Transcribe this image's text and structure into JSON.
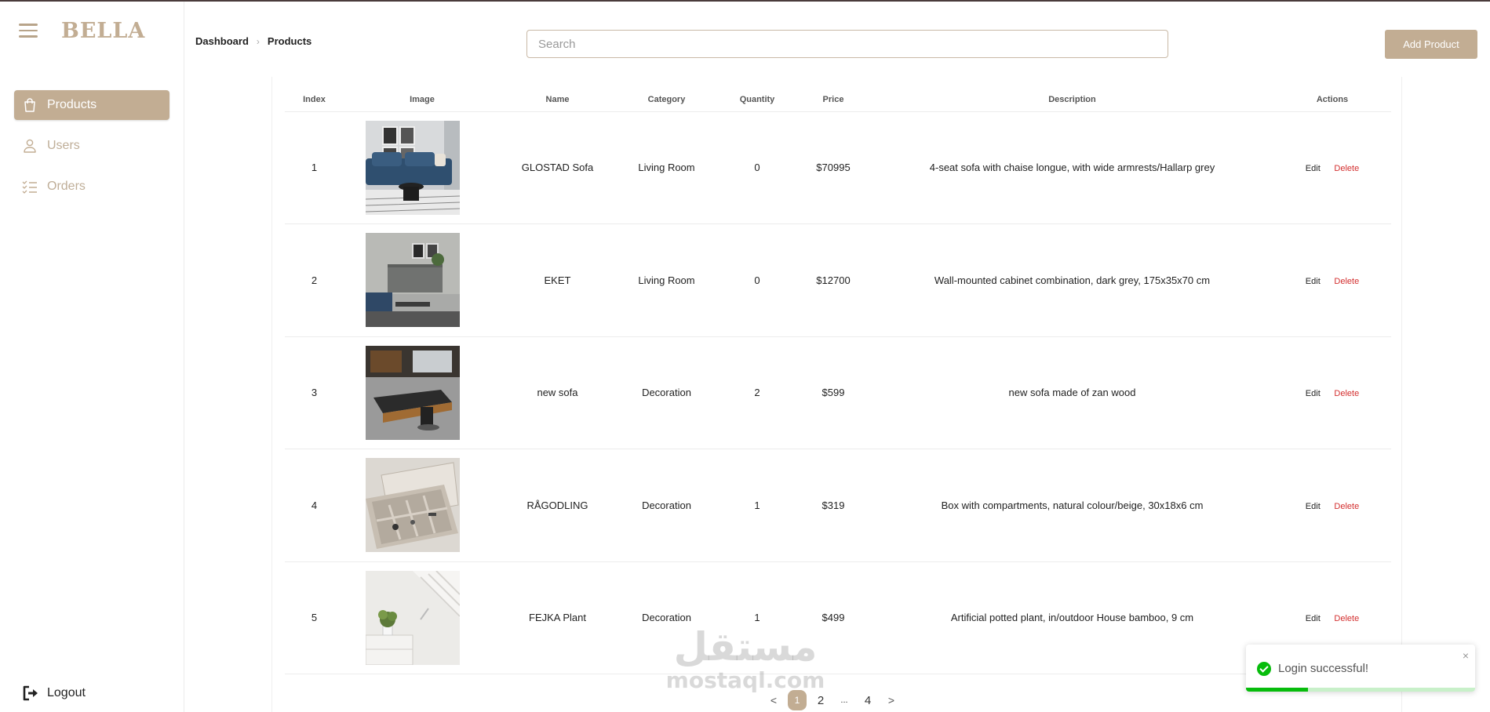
{
  "brand": {
    "name": "BELLA"
  },
  "sidebar": {
    "items": [
      {
        "label": "Products",
        "icon": "shopping-bag-icon",
        "active": true
      },
      {
        "label": "Users",
        "icon": "user-icon",
        "active": false
      },
      {
        "label": "Orders",
        "icon": "checklist-icon",
        "active": false
      }
    ],
    "logout_label": "Logout"
  },
  "breadcrumb": {
    "root": "Dashboard",
    "current": "Products"
  },
  "search": {
    "placeholder": "Search",
    "value": ""
  },
  "header": {
    "add_button_label": "Add Product"
  },
  "table": {
    "columns": [
      "Index",
      "Image",
      "Name",
      "Category",
      "Quantity",
      "Price",
      "Description",
      "Actions"
    ],
    "rows": [
      {
        "index": "1",
        "image": "blue-sofa-room-photo",
        "name": "GLOSTAD Sofa",
        "category": "Living Room",
        "quantity": "0",
        "price": "$70995",
        "description": "4-seat sofa with chaise longue, with wide armrests/Hallarp grey",
        "edit": "Edit",
        "delete": "Delete"
      },
      {
        "index": "2",
        "image": "grey-cabinet-room-photo",
        "name": "EKET",
        "category": "Living Room",
        "quantity": "0",
        "price": "$12700",
        "description": "Wall-mounted cabinet combination, dark grey, 175x35x70 cm",
        "edit": "Edit",
        "delete": "Delete"
      },
      {
        "index": "3",
        "image": "office-desk-photo",
        "name": "new sofa",
        "category": "Decoration",
        "quantity": "2",
        "price": "$599",
        "description": "new sofa made of zan wood",
        "edit": "Edit",
        "delete": "Delete"
      },
      {
        "index": "4",
        "image": "compartment-box-photo",
        "name": "RÅGODLING",
        "category": "Decoration",
        "quantity": "1",
        "price": "$319",
        "description": "Box with compartments, natural colour/beige, 30x18x6 cm",
        "edit": "Edit",
        "delete": "Delete"
      },
      {
        "index": "5",
        "image": "potted-plant-photo",
        "name": "FEJKA Plant",
        "category": "Decoration",
        "quantity": "1",
        "price": "$499",
        "description": "Artificial potted plant, in/outdoor House bamboo, 9 cm",
        "edit": "Edit",
        "delete": "Delete"
      }
    ]
  },
  "pagination": {
    "prev": "<",
    "pages": [
      "1",
      "2",
      "...",
      "4"
    ],
    "current": "1",
    "next": ">"
  },
  "watermark": {
    "arabic": "مستقل",
    "latin": "mostaql.com"
  },
  "toast": {
    "message": "Login successful!",
    "close": "×",
    "progress": 0.27
  },
  "colors": {
    "accent": "#c2ad93",
    "danger": "#d32f2f",
    "success": "#07bc0c"
  }
}
